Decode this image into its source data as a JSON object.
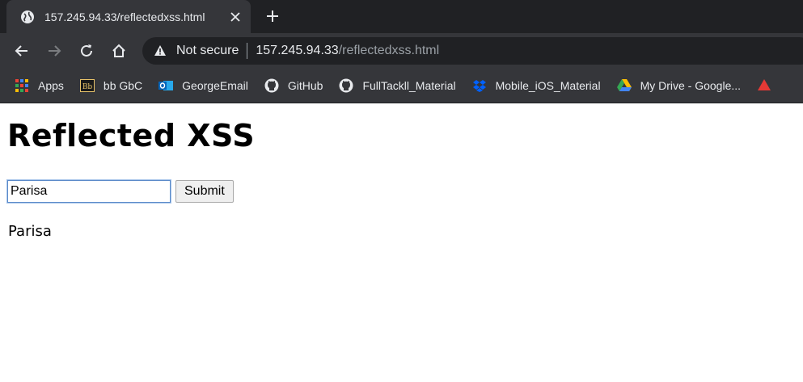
{
  "tab": {
    "title": "157.245.94.33/reflectedxss.html",
    "favicon": "globe-icon"
  },
  "toolbar": {
    "security_label": "Not secure",
    "url_host": "157.245.94.33",
    "url_path": "/reflectedxss.html"
  },
  "bookmarks": [
    {
      "label": "Apps",
      "icon": "apps-grid-icon"
    },
    {
      "label": "bb GbC",
      "icon": "blackboard-icon"
    },
    {
      "label": "GeorgeEmail",
      "icon": "outlook-icon"
    },
    {
      "label": "GitHub",
      "icon": "github-icon"
    },
    {
      "label": "FullTackll_Material",
      "icon": "github-icon"
    },
    {
      "label": "Mobile_iOS_Material",
      "icon": "dropbox-icon"
    },
    {
      "label": "My Drive - Google...",
      "icon": "google-drive-icon"
    }
  ],
  "page": {
    "heading": "Reflected XSS",
    "input_value": "Parisa",
    "submit_label": "Submit",
    "reflected_text": "Parisa"
  },
  "colors": {
    "chrome_dark": "#202124",
    "chrome_toolbar": "#35363a",
    "text_light": "#e8eaed",
    "text_muted": "#9aa0a6"
  }
}
